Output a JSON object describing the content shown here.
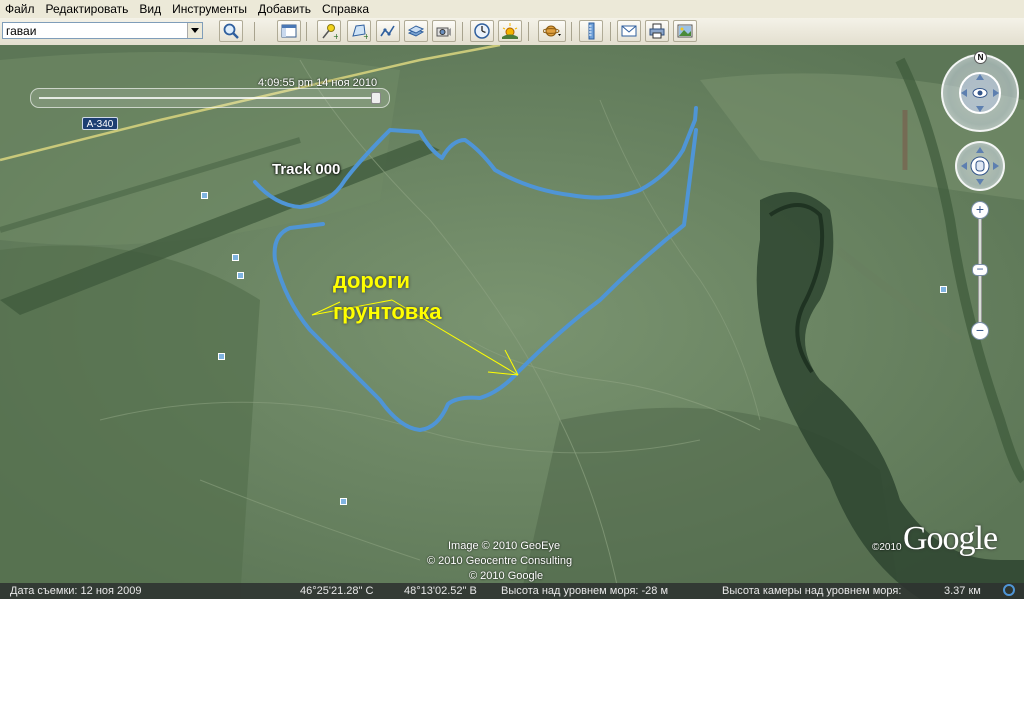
{
  "menu": [
    "Файл",
    "Редактировать",
    "Вид",
    "Инструменты",
    "Добавить",
    "Справка"
  ],
  "search": {
    "value": "гаваи"
  },
  "toolbar_buttons": [
    "search-button",
    "sidebar-toggle-button",
    "add-placemark-button",
    "add-polygon-button",
    "add-path-button",
    "add-image-overlay-button",
    "record-tour-button",
    "historical-imagery-button",
    "sunlight-button",
    "switch-sky-button",
    "ruler-button",
    "email-button",
    "print-button",
    "save-image-button"
  ],
  "time": {
    "label": "4:09:55 pm 14 ноя 2010"
  },
  "map": {
    "route_label": "А-340",
    "track_label": "Track 000",
    "annotation_line1": "дороги",
    "annotation_line2": "грунтовка",
    "track_color": "#4f95d6"
  },
  "credits": {
    "line1": "Image © 2010 GeoEye",
    "line2": "© 2010 Geocentre Consulting",
    "line3": "© 2010 Google"
  },
  "google": {
    "year": "©2010",
    "logo": "Google"
  },
  "navigation": {
    "north": "N"
  },
  "status": {
    "date": "Дата съемки: 12 ноя 2009",
    "lat": "46°25'21.28\" С",
    "lon": "48°13'02.52\" В",
    "elevation": "Высота над уровнем моря:  -28 м",
    "eye_alt": "Высота камеры над уровнем моря:",
    "eye_alt_value": "3.37 км"
  }
}
